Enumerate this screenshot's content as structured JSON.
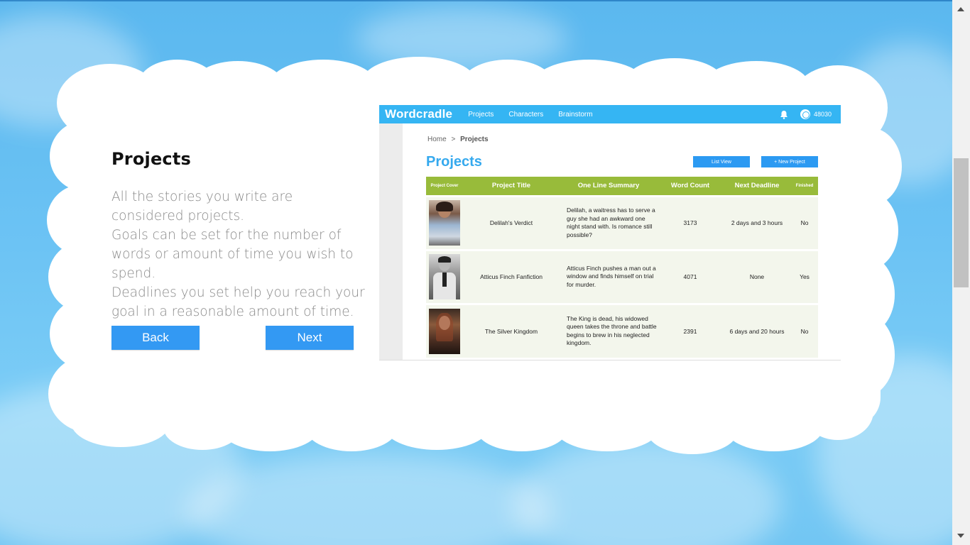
{
  "intro": {
    "title": "Projects",
    "body": "All the stories you write are considered projects.\nGoals can be set for the number of words or amount of time you wish to spend.\nDeadlines you set help you reach your goal in a reasonable amount of time.",
    "back_label": "Back",
    "next_label": "Next"
  },
  "app": {
    "logo": "Wordcradle",
    "nav": [
      "Projects",
      "Characters",
      "Brainstorm"
    ],
    "points": "48030",
    "breadcrumb_home": "Home",
    "breadcrumb_sep": ">",
    "breadcrumb_current": "Projects",
    "page_title": "Projects",
    "list_view_label": "List View",
    "new_project_label": "+ New Project",
    "columns": [
      "Project Cover",
      "Project Title",
      "One Line Summary",
      "Word Count",
      "Next Deadline",
      "Finished"
    ],
    "rows": [
      {
        "title": "Delilah's Verdict",
        "summary": "Delilah, a waitress has to serve a guy she had an awkward one night stand with. Is romance still possible?",
        "word_count": "3173",
        "deadline": "2 days and 3 hours",
        "finished": "No"
      },
      {
        "title": "Atticus Finch Fanfiction",
        "summary": "Atticus Finch pushes a man out a window and finds himself on trial for murder.",
        "word_count": "4071",
        "deadline": "None",
        "finished": "Yes"
      },
      {
        "title": "The Silver Kingdom",
        "summary": "The King is dead, his widowed queen takes the throne and battle begins to brew in his neglected kingdom.",
        "word_count": "2391",
        "deadline": "6 days and 20 hours",
        "finished": "No"
      }
    ]
  },
  "colors": {
    "accent": "#3399f3",
    "app_nav": "#35b5f3",
    "table_header": "#98bb3a",
    "sky": "#5bb8ef"
  }
}
